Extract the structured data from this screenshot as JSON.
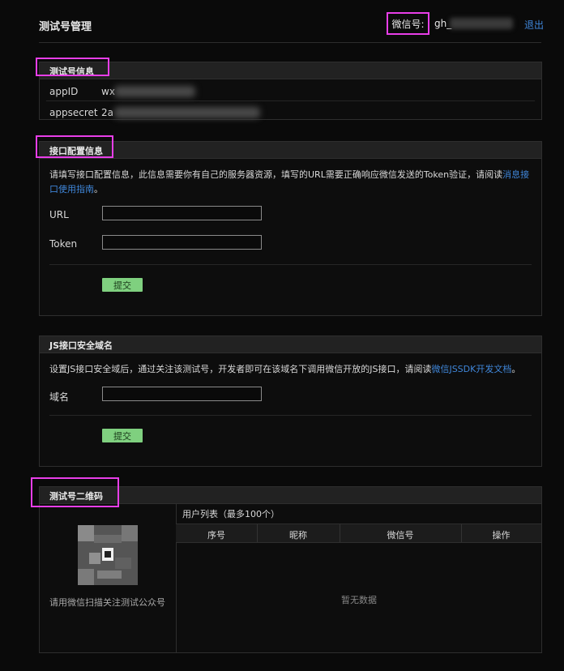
{
  "header": {
    "title": "测试号管理",
    "wechat_label": "微信号:",
    "wechat_value": "gh_",
    "logout": "退出"
  },
  "test_info": {
    "title": "测试号信息",
    "rows": [
      {
        "label": "appID",
        "value": "wx"
      },
      {
        "label": "appsecret",
        "value": "2a"
      }
    ]
  },
  "api_config": {
    "title": "接口配置信息",
    "desc_before": "请填写接口配置信息，此信息需要你有自己的服务器资源，填写的URL需要正确响应微信发送的Token验证，请阅读",
    "desc_link": "消息接口使用指南",
    "desc_after": "。",
    "url_label": "URL",
    "url_value": "",
    "token_label": "Token",
    "token_value": "",
    "submit": "提交"
  },
  "js_domain": {
    "title": "JS接口安全域名",
    "desc_before": "设置JS接口安全域后，通过关注该测试号，开发者即可在该域名下调用微信开放的JS接口，请阅读",
    "desc_link": "微信JSSDK开发文档",
    "desc_after": "。",
    "domain_label": "域名",
    "domain_value": "",
    "submit": "提交"
  },
  "qr_section": {
    "title": "测试号二维码",
    "qr_caption": "请用微信扫描关注测试公众号",
    "user_list_title": "用户列表（最多100个）",
    "columns": [
      "序号",
      "昵称",
      "微信号",
      "操作"
    ],
    "empty": "暂无数据"
  },
  "colors": {
    "accent_link": "#3f86d9",
    "button_green": "#7fd07f",
    "highlight_box": "#e83ee8"
  }
}
